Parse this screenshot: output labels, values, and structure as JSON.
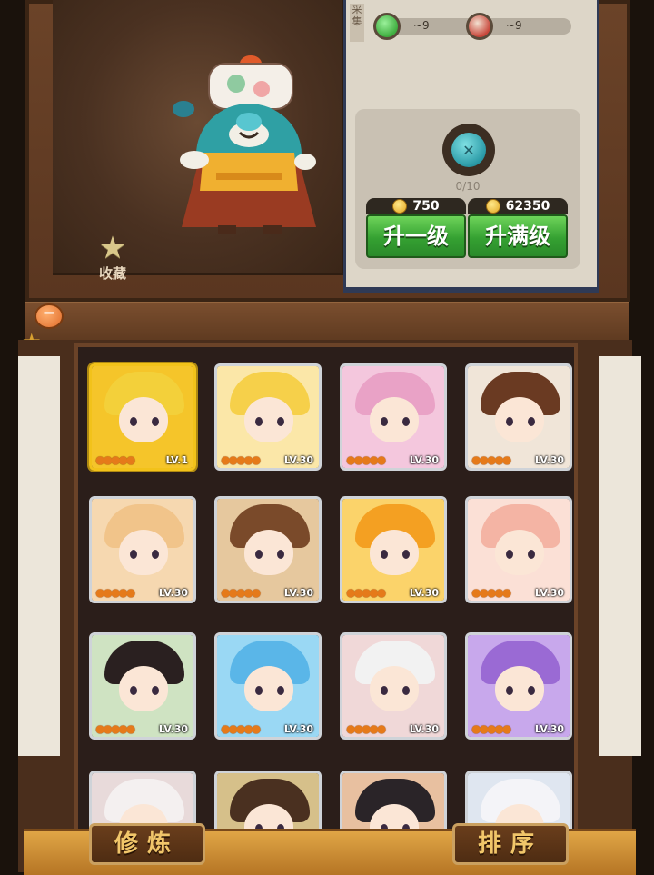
{
  "favorite": {
    "label": "收藏"
  },
  "side_tab": {
    "label": "采集"
  },
  "materials": [
    {
      "name": "green-orb",
      "count": "~9",
      "color": "#3fae3f"
    },
    {
      "name": "red-bowl",
      "count": "~9",
      "color": "#c8463a"
    }
  ],
  "upgrade": {
    "progress": "0/10",
    "one_level": {
      "cost": "750",
      "label": "升一级"
    },
    "max_level": {
      "cost": "62350",
      "label": "升满级"
    }
  },
  "cards": [
    {
      "level": "LV.1",
      "selected": true,
      "hair": "#f3d03a",
      "bg": "#f5c52a"
    },
    {
      "level": "LV.30",
      "selected": false,
      "hair": "#f6d04a",
      "bg": "#fbe7a8"
    },
    {
      "level": "LV.30",
      "selected": false,
      "hair": "#e9a2c6",
      "bg": "#f4c7dd"
    },
    {
      "level": "LV.30",
      "selected": false,
      "hair": "#6a3a22",
      "bg": "#f0e5d8"
    },
    {
      "level": "LV.30",
      "selected": false,
      "hair": "#f1c48a",
      "bg": "#f6d8b0"
    },
    {
      "level": "LV.30",
      "selected": false,
      "hair": "#7a4a2a",
      "bg": "#e6c89e"
    },
    {
      "level": "LV.30",
      "selected": false,
      "hair": "#f4a022",
      "bg": "#fbd36a"
    },
    {
      "level": "LV.30",
      "selected": false,
      "hair": "#f4b4a4",
      "bg": "#fbe0d6"
    },
    {
      "level": "LV.30",
      "selected": false,
      "hair": "#2a2020",
      "bg": "#cfe3c2"
    },
    {
      "level": "LV.30",
      "selected": false,
      "hair": "#5ab6e8",
      "bg": "#9ad8f4"
    },
    {
      "level": "LV.30",
      "selected": false,
      "hair": "#f2f2f2",
      "bg": "#f0d8d8"
    },
    {
      "level": "LV.30",
      "selected": false,
      "hair": "#9a6ad4",
      "bg": "#c8a8ec"
    },
    {
      "level": "",
      "selected": false,
      "hair": "#f4f0f0",
      "bg": "#e8dada"
    },
    {
      "level": "",
      "selected": false,
      "hair": "#4a3020",
      "bg": "#d6c08a"
    },
    {
      "level": "",
      "selected": false,
      "hair": "#2a2428",
      "bg": "#e8c0a0"
    },
    {
      "level": "",
      "selected": false,
      "hair": "#f4f4f8",
      "bg": "#dfe6f0"
    }
  ],
  "card_stars": "●●●●●",
  "bottom": {
    "cultivate_label": "修炼",
    "sort_label": "排序"
  }
}
